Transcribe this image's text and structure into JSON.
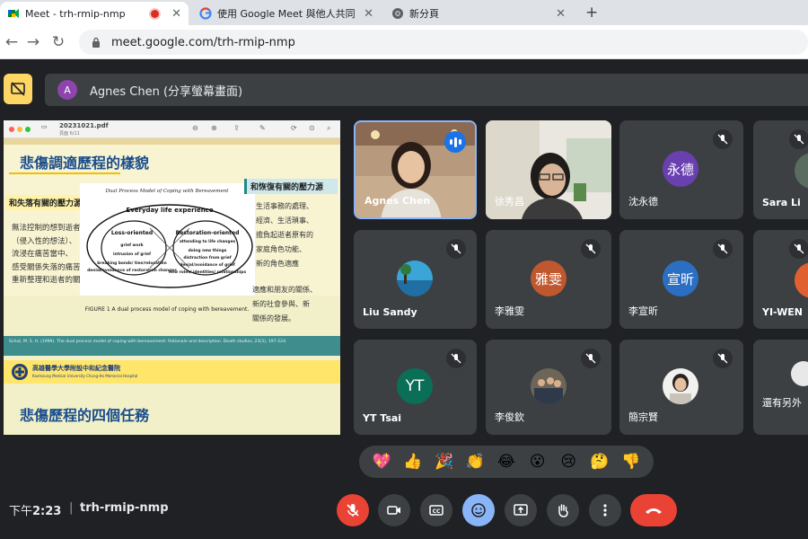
{
  "browser": {
    "tabs": [
      {
        "title": "Meet - trh-rmip-nmp",
        "active": true,
        "recording": true
      },
      {
        "title": "使用 Google Meet 與他人共同",
        "active": false
      },
      {
        "title": "新分頁",
        "active": false
      }
    ],
    "new_tab_symbol": "+",
    "url": "meet.google.com/trh-rmip-nmp"
  },
  "meet": {
    "presenter_initial": "A",
    "presenter_text": "Agnes Chen (分享螢幕畫面)",
    "slide": {
      "pdf_name": "20231021.pdf",
      "pdf_page": "頁面 6/11",
      "title_top": "悲傷調適歷程的樣貌",
      "left_box": "和失落有關的壓力源",
      "left_lines": [
        "無法控制的想到逝者",
        "（侵入性的想法）、",
        "流浸在痛苦當中、",
        "感受關係失落的痛苦、",
        "重新整理和逝者的關係"
      ],
      "right_box": "和恢復有關的壓力源",
      "right_lines": [
        "生活事務的處理、",
        "經濟、生活瑣事、",
        "擔負起逝者原有的",
        "家庭角色功能、",
        "新的角色適應",
        "",
        "適應和朋友的關係、",
        "新的社會參與、新",
        "關係的發展。"
      ],
      "diagram": {
        "caption_title": "Dual Process Model of Coping with Bereavement",
        "center": "Everyday life experience",
        "loss_title": "Loss-oriented",
        "loss_items": [
          "grief work",
          "intrusion of grief",
          "breaking bonds/ ties/relocation",
          "denial/avoidance of restoration changes"
        ],
        "restoration_title": "Restoration-oriented",
        "restoration_items": [
          "attending to life changes",
          "doing new things",
          "distraction from grief",
          "denial/avoidance of grief",
          "new roles/ identities/ relationships"
        ],
        "figure_caption": "FIGURE 1  A dual process model of coping with bereavement."
      },
      "citation": "Schut, M. S. H. (1999). The dual process model of coping with bereavement: Rationale and description. Death studies, 23(3), 197-224.",
      "org_name": "高雄醫學大學附設中和紀念醫院",
      "org_name_en": "Kaohsiung Medical University Chung-Ho Memorial Hospital",
      "title_bottom": "悲傷歷程的四個任務"
    },
    "tiles": [
      {
        "name": "Agnes Chen",
        "speaking": true
      },
      {
        "name": "徐秀昌"
      },
      {
        "name": "沈永德",
        "avatar": "永德",
        "muted": true
      },
      {
        "name": "Sara Li",
        "muted": true
      },
      {
        "name": "Liu Sandy",
        "muted": true
      },
      {
        "name": "李雅雯",
        "avatar": "雅雯",
        "muted": true
      },
      {
        "name": "李宣昕",
        "avatar": "宣昕",
        "muted": true
      },
      {
        "name": "YI-WEN",
        "muted": true
      },
      {
        "name": "YT Tsai",
        "avatar": "YT",
        "muted": true
      },
      {
        "name": "李俊欽",
        "muted": true
      },
      {
        "name": "簡宗賢",
        "muted": true
      },
      {
        "name": "還有另外"
      }
    ],
    "reactions": [
      "💖",
      "👍",
      "🎉",
      "👏",
      "😂",
      "😮",
      "😢",
      "🤔",
      "👎"
    ],
    "time": "下午",
    "time_value": "2:23",
    "separator": "|",
    "meeting_code": "trh-rmip-nmp",
    "controls": [
      "mic-off-icon",
      "camera-icon",
      "captions-icon",
      "emoji-icon",
      "present-icon",
      "raise-hand-icon",
      "more-icon",
      "leave-call-icon"
    ],
    "colors": {
      "background": "#202124",
      "tile": "#3c4043",
      "danger": "#ea4335",
      "accent": "#8ab4f8",
      "present": "#fdd663"
    }
  }
}
